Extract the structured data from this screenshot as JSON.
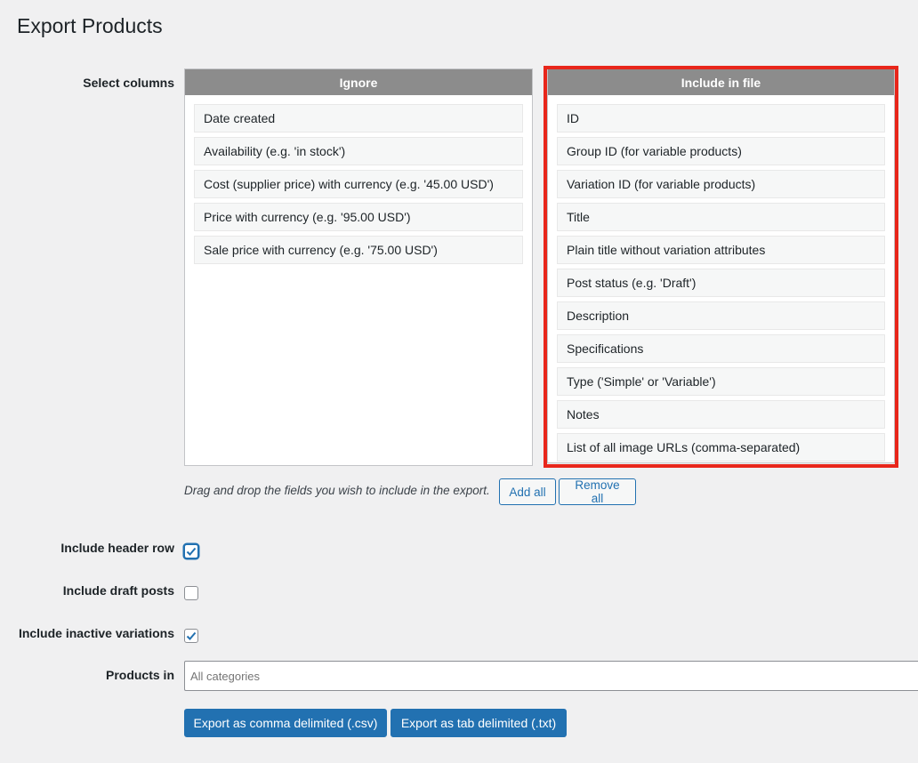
{
  "page": {
    "title": "Export Products"
  },
  "columns": {
    "label": "Select columns",
    "ignore": {
      "header": "Ignore",
      "items": [
        "Date created",
        "Availability (e.g. 'in stock')",
        "Cost (supplier price) with currency (e.g. '45.00 USD')",
        "Price with currency (e.g. '95.00 USD')",
        "Sale price with currency (e.g. '75.00 USD')"
      ]
    },
    "include": {
      "header": "Include in file",
      "items": [
        "ID",
        "Group ID (for variable products)",
        "Variation ID (for variable products)",
        "Title",
        "Plain title without variation attributes",
        "Post status (e.g. 'Draft')",
        "Description",
        "Specifications",
        "Type ('Simple' or 'Variable')",
        "Notes",
        "List of all image URLs (comma-separated)"
      ]
    },
    "hint": "Drag and drop the fields you wish to include in the export.",
    "add_all": "Add all",
    "remove_all": "Remove all"
  },
  "options": {
    "header_row": {
      "label": "Include header row",
      "checked": true
    },
    "draft_posts": {
      "label": "Include draft posts",
      "checked": false
    },
    "inactive_variations": {
      "label": "Include inactive variations",
      "checked": true
    }
  },
  "products_in": {
    "label": "Products in",
    "placeholder": "All categories"
  },
  "actions": {
    "export_csv": "Export as comma delimited (.csv)",
    "export_txt": "Export as tab delimited (.txt)"
  },
  "colors": {
    "accent": "#2271b1",
    "highlight": "#e8261b",
    "panel_header": "#8c8c8c"
  }
}
